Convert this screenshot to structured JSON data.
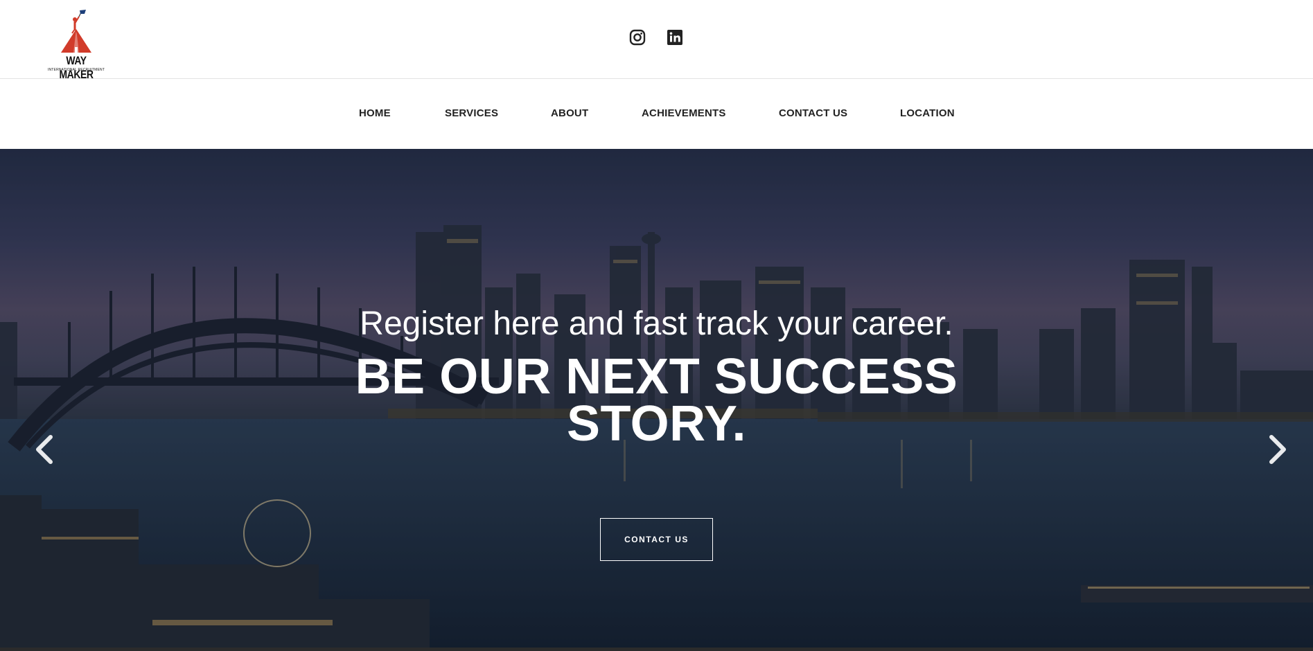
{
  "brand": {
    "name": "WAY MAKER",
    "tagline": "INTERNATIONAL RECRUITMENT",
    "colors": {
      "accent": "#d13b2a",
      "flag": "#1d3f7a"
    }
  },
  "social": {
    "instagram": "instagram-icon",
    "linkedin": "linkedin-icon"
  },
  "nav": {
    "items": [
      {
        "label": "HOME"
      },
      {
        "label": "SERVICES"
      },
      {
        "label": "ABOUT"
      },
      {
        "label": "ACHIEVEMENTS"
      },
      {
        "label": "CONTACT US"
      },
      {
        "label": "LOCATION"
      }
    ]
  },
  "hero": {
    "subtitle": "Register here and fast track your career.",
    "title": "BE OUR NEXT SUCCESS STORY.",
    "button_label": "CONTACT US",
    "prev_icon": "chevron-left-icon",
    "next_icon": "chevron-right-icon"
  }
}
